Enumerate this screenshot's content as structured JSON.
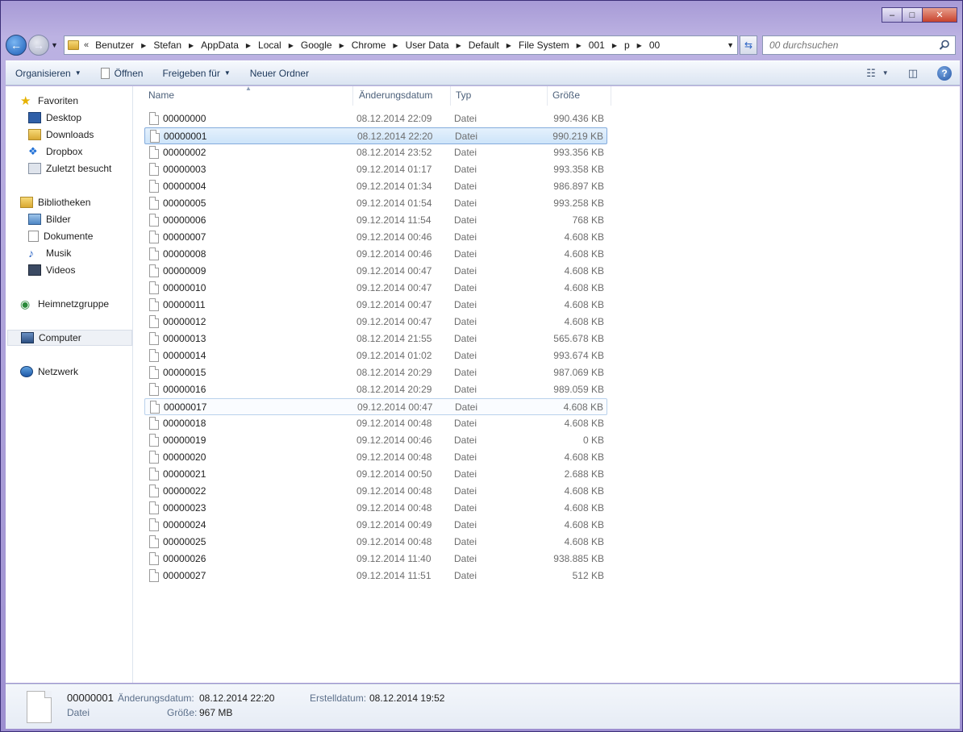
{
  "window": {
    "caption_minimize": "–",
    "caption_maximize": "□",
    "caption_close": "✕"
  },
  "address": {
    "overflow": "«",
    "crumbs": [
      "Benutzer",
      "Stefan",
      "AppData",
      "Local",
      "Google",
      "Chrome",
      "User Data",
      "Default",
      "File System",
      "001",
      "p",
      "00"
    ]
  },
  "search": {
    "placeholder": "00 durchsuchen"
  },
  "toolbar": {
    "organize": "Organisieren",
    "open": "Öffnen",
    "share": "Freigeben für",
    "new_folder": "Neuer Ordner",
    "help": "?"
  },
  "nav": {
    "favorites": "Favoriten",
    "desktop": "Desktop",
    "downloads": "Downloads",
    "dropbox": "Dropbox",
    "recent": "Zuletzt besucht",
    "libraries": "Bibliotheken",
    "pictures": "Bilder",
    "documents": "Dokumente",
    "music": "Musik",
    "videos": "Videos",
    "homegroup": "Heimnetzgruppe",
    "computer": "Computer",
    "network": "Netzwerk"
  },
  "columns": {
    "name": "Name",
    "date": "Änderungsdatum",
    "type": "Typ",
    "size": "Größe"
  },
  "files": [
    {
      "name": "00000000",
      "date": "08.12.2014 22:09",
      "type": "Datei",
      "size": "990.436 KB"
    },
    {
      "name": "00000001",
      "date": "08.12.2014 22:20",
      "type": "Datei",
      "size": "990.219 KB"
    },
    {
      "name": "00000002",
      "date": "08.12.2014 23:52",
      "type": "Datei",
      "size": "993.356 KB"
    },
    {
      "name": "00000003",
      "date": "09.12.2014 01:17",
      "type": "Datei",
      "size": "993.358 KB"
    },
    {
      "name": "00000004",
      "date": "09.12.2014 01:34",
      "type": "Datei",
      "size": "986.897 KB"
    },
    {
      "name": "00000005",
      "date": "09.12.2014 01:54",
      "type": "Datei",
      "size": "993.258 KB"
    },
    {
      "name": "00000006",
      "date": "09.12.2014 11:54",
      "type": "Datei",
      "size": "768 KB"
    },
    {
      "name": "00000007",
      "date": "09.12.2014 00:46",
      "type": "Datei",
      "size": "4.608 KB"
    },
    {
      "name": "00000008",
      "date": "09.12.2014 00:46",
      "type": "Datei",
      "size": "4.608 KB"
    },
    {
      "name": "00000009",
      "date": "09.12.2014 00:47",
      "type": "Datei",
      "size": "4.608 KB"
    },
    {
      "name": "00000010",
      "date": "09.12.2014 00:47",
      "type": "Datei",
      "size": "4.608 KB"
    },
    {
      "name": "00000011",
      "date": "09.12.2014 00:47",
      "type": "Datei",
      "size": "4.608 KB"
    },
    {
      "name": "00000012",
      "date": "09.12.2014 00:47",
      "type": "Datei",
      "size": "4.608 KB"
    },
    {
      "name": "00000013",
      "date": "08.12.2014 21:55",
      "type": "Datei",
      "size": "565.678 KB"
    },
    {
      "name": "00000014",
      "date": "09.12.2014 01:02",
      "type": "Datei",
      "size": "993.674 KB"
    },
    {
      "name": "00000015",
      "date": "08.12.2014 20:29",
      "type": "Datei",
      "size": "987.069 KB"
    },
    {
      "name": "00000016",
      "date": "08.12.2014 20:29",
      "type": "Datei",
      "size": "989.059 KB"
    },
    {
      "name": "00000017",
      "date": "09.12.2014 00:47",
      "type": "Datei",
      "size": "4.608 KB"
    },
    {
      "name": "00000018",
      "date": "09.12.2014 00:48",
      "type": "Datei",
      "size": "4.608 KB"
    },
    {
      "name": "00000019",
      "date": "09.12.2014 00:46",
      "type": "Datei",
      "size": "0 KB"
    },
    {
      "name": "00000020",
      "date": "09.12.2014 00:48",
      "type": "Datei",
      "size": "4.608 KB"
    },
    {
      "name": "00000021",
      "date": "09.12.2014 00:50",
      "type": "Datei",
      "size": "2.688 KB"
    },
    {
      "name": "00000022",
      "date": "09.12.2014 00:48",
      "type": "Datei",
      "size": "4.608 KB"
    },
    {
      "name": "00000023",
      "date": "09.12.2014 00:48",
      "type": "Datei",
      "size": "4.608 KB"
    },
    {
      "name": "00000024",
      "date": "09.12.2014 00:49",
      "type": "Datei",
      "size": "4.608 KB"
    },
    {
      "name": "00000025",
      "date": "09.12.2014 00:48",
      "type": "Datei",
      "size": "4.608 KB"
    },
    {
      "name": "00000026",
      "date": "09.12.2014 11:40",
      "type": "Datei",
      "size": "938.885 KB"
    },
    {
      "name": "00000027",
      "date": "09.12.2014 11:51",
      "type": "Datei",
      "size": "512 KB"
    }
  ],
  "selected_index": 1,
  "hover_index": 17,
  "details": {
    "name": "00000001",
    "type": "Datei",
    "modified_label": "Änderungsdatum:",
    "modified_value": "08.12.2014 22:20",
    "size_label": "Größe:",
    "size_value": "967 MB",
    "created_label": "Erstelldatum:",
    "created_value": "08.12.2014 19:52"
  }
}
